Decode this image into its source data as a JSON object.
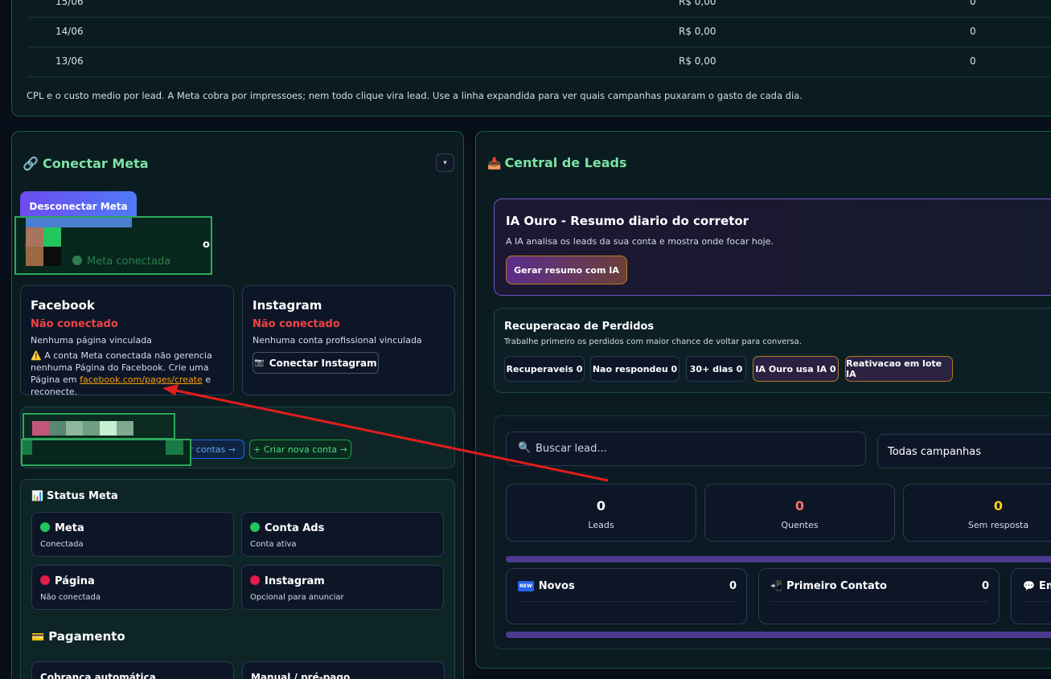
{
  "report": {
    "rows": [
      {
        "date": "15/06",
        "value": "R$ 0,00",
        "count": "0"
      },
      {
        "date": "14/06",
        "value": "R$ 0,00",
        "count": "0"
      },
      {
        "date": "13/06",
        "value": "R$ 0,00",
        "count": "0"
      }
    ],
    "note": "CPL e o custo medio por lead. A Meta cobra por impressoes; nem todo clique vira lead. Use a linha expandida para ver quais campanhas puxaram o gasto de cada dia."
  },
  "meta": {
    "title": "Conectar Meta",
    "collapse_glyph": "▾",
    "disconnect_label": "Desconectar Meta",
    "connected_label": "Meta conectada",
    "facebook": {
      "title": "Facebook",
      "status": "Não conectado",
      "desc": "Nenhuma página vinculada",
      "warn_text": "A conta Meta conectada não gerencia nenhuma Página do Facebook. Crie uma Página em",
      "link": "facebook.com/pages/create",
      "warn_tail": "e reconecte."
    },
    "instagram": {
      "title": "Instagram",
      "status": "Não conectado",
      "desc": "Nenhuma conta profissional vinculada",
      "button": "Conectar Instagram"
    },
    "accounts": {
      "manage_label": "ciar contas →",
      "create_label": "+ Criar nova conta →"
    },
    "status": {
      "title": "Status Meta",
      "items": [
        {
          "title": "Meta",
          "desc": "Conectada",
          "color": "#22c55e"
        },
        {
          "title": "Conta Ads",
          "desc": "Conta ativa",
          "color": "#22c55e"
        },
        {
          "title": "Página",
          "desc": "Não conectada",
          "color": "#e11d48"
        },
        {
          "title": "Instagram",
          "desc": "Opcional para anunciar",
          "color": "#e11d48"
        }
      ]
    },
    "payment": {
      "title": "Pagamento",
      "auto_label": "Cobrança automática",
      "manual_label": "Manual / pré-pago"
    }
  },
  "leads": {
    "title": "Central de Leads",
    "ia": {
      "title": "IA Ouro - Resumo diario do corretor",
      "desc": "A IA analisa os leads da sua conta e mostra onde focar hoje.",
      "button": "Gerar resumo com IA"
    },
    "recovery": {
      "title": "Recuperacao de Perdidos",
      "desc": "Trabalhe primeiro os perdidos com maior chance de voltar para conversa.",
      "chips": [
        "Recuperaveis 0",
        "Nao respondeu 0",
        "30+ dias 0",
        "IA Ouro usa IA 0",
        "Reativacao em lote IA"
      ]
    },
    "search_placeholder": "Buscar lead...",
    "campaign_select": "Todas campanhas",
    "stats": [
      {
        "value": "0",
        "label": "Leads",
        "color": "#ffffff"
      },
      {
        "value": "0",
        "label": "Quentes",
        "color": "#f87171"
      },
      {
        "value": "0",
        "label": "Sem resposta",
        "color": "#facc15"
      }
    ],
    "columns": [
      {
        "title": "Novos",
        "count": "0"
      },
      {
        "title": "Primeiro Contato",
        "count": "0"
      },
      {
        "title": "Em",
        "count": ""
      }
    ]
  }
}
